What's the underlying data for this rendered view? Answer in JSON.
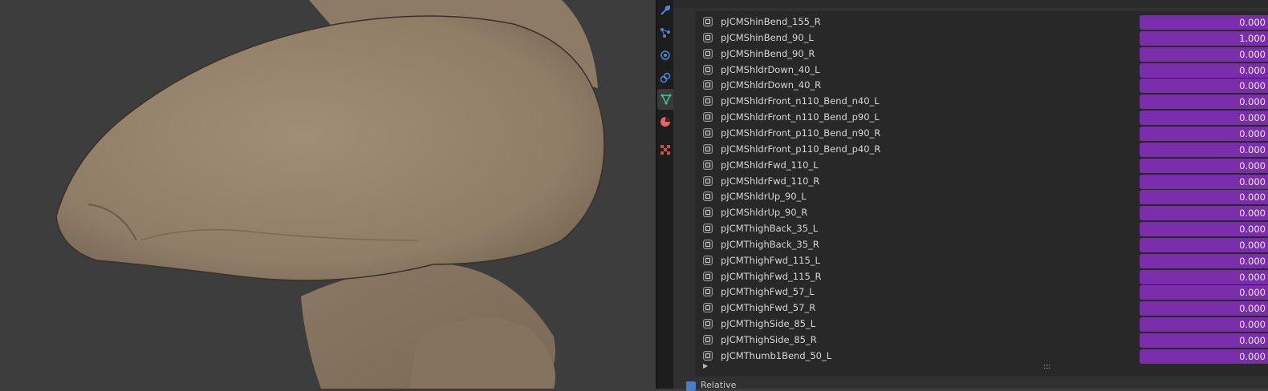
{
  "viewport": {
    "label": ""
  },
  "tabs": [
    {
      "icon": "wrench-icon",
      "color": "#4f86d6"
    },
    {
      "icon": "particles-icon",
      "color": "#4f86d6"
    },
    {
      "icon": "physics-icon",
      "color": "#4f86d6"
    },
    {
      "icon": "constraints-icon",
      "color": "#4f86d6"
    },
    {
      "icon": "object-data-icon",
      "color": "#33cc99"
    },
    {
      "icon": "material-icon",
      "color": "#e26464"
    },
    {
      "icon": "texture-icon",
      "color": "#c85050"
    }
  ],
  "shape_keys": [
    {
      "name": "pJCMShinBend_155_R",
      "value": "0.000"
    },
    {
      "name": "pJCMShinBend_90_L",
      "value": "1.000"
    },
    {
      "name": "pJCMShinBend_90_R",
      "value": "0.000"
    },
    {
      "name": "pJCMShldrDown_40_L",
      "value": "0.000"
    },
    {
      "name": "pJCMShldrDown_40_R",
      "value": "0.000"
    },
    {
      "name": "pJCMShldrFront_n110_Bend_n40_L",
      "value": "0.000"
    },
    {
      "name": "pJCMShldrFront_n110_Bend_p90_L",
      "value": "0.000"
    },
    {
      "name": "pJCMShldrFront_p110_Bend_n90_R",
      "value": "0.000"
    },
    {
      "name": "pJCMShldrFront_p110_Bend_p40_R",
      "value": "0.000"
    },
    {
      "name": "pJCMShldrFwd_110_L",
      "value": "0.000"
    },
    {
      "name": "pJCMShldrFwd_110_R",
      "value": "0.000"
    },
    {
      "name": "pJCMShldrUp_90_L",
      "value": "0.000"
    },
    {
      "name": "pJCMShldrUp_90_R",
      "value": "0.000"
    },
    {
      "name": "pJCMThighBack_35_L",
      "value": "0.000"
    },
    {
      "name": "pJCMThighBack_35_R",
      "value": "0.000"
    },
    {
      "name": "pJCMThighFwd_115_L",
      "value": "0.000"
    },
    {
      "name": "pJCMThighFwd_115_R",
      "value": "0.000"
    },
    {
      "name": "pJCMThighFwd_57_L",
      "value": "0.000"
    },
    {
      "name": "pJCMThighFwd_57_R",
      "value": "0.000"
    },
    {
      "name": "pJCMThighSide_85_L",
      "value": "0.000"
    },
    {
      "name": "pJCMThighSide_85_R",
      "value": "0.000"
    },
    {
      "name": "pJCMThumb1Bend_50_L",
      "value": "0.000"
    }
  ],
  "list_footer": {
    "grip": "::::"
  },
  "panel_footer": {
    "label": "Relative"
  },
  "colors": {
    "value_bar": "#7b2eac",
    "skin": "#9c8a73"
  }
}
